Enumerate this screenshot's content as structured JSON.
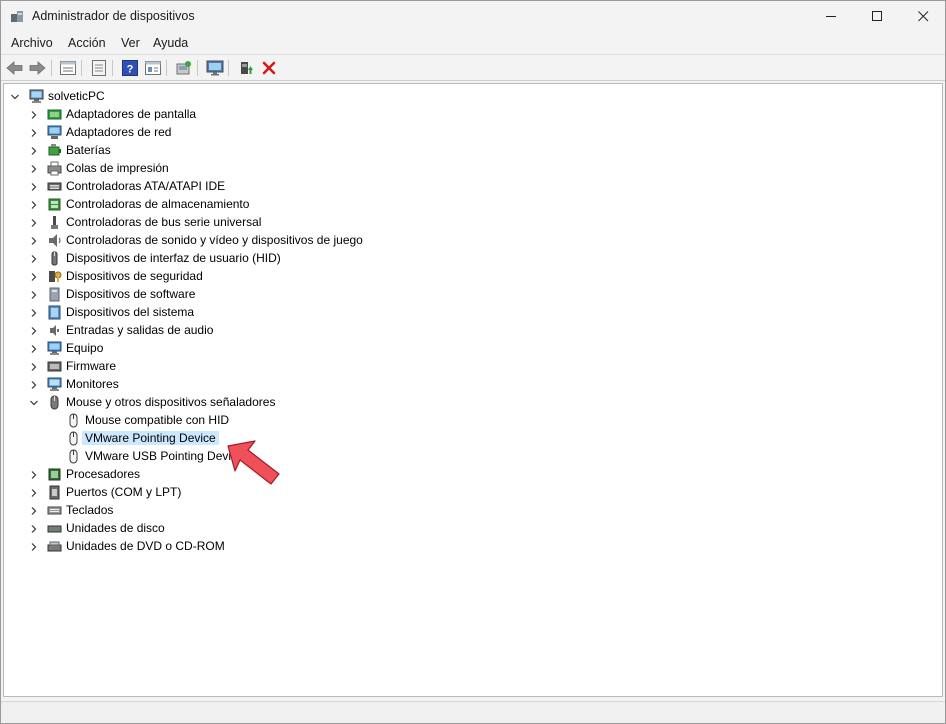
{
  "window": {
    "title": "Administrador de dispositivos"
  },
  "menu": [
    "Archivo",
    "Acción",
    "Ver",
    "Ayuda"
  ],
  "toolbar_icons": [
    "back-arrow-icon",
    "forward-arrow-icon",
    "properties-icon",
    "document-icon",
    "help-icon",
    "view-icon",
    "scan-hardware-icon",
    "monitor-icon",
    "update-driver-icon",
    "uninstall-x-icon"
  ],
  "tree": {
    "root": "solveticPC",
    "categories": [
      {
        "label": "Adaptadores de pantalla",
        "icon": "display-adapter-icon",
        "expanded": false
      },
      {
        "label": "Adaptadores de red",
        "icon": "network-adapter-icon",
        "expanded": false
      },
      {
        "label": "Baterías",
        "icon": "battery-icon",
        "expanded": false
      },
      {
        "label": "Colas de impresión",
        "icon": "printer-icon",
        "expanded": false
      },
      {
        "label": "Controladoras ATA/ATAPI IDE",
        "icon": "ide-controller-icon",
        "expanded": false
      },
      {
        "label": "Controladoras de almacenamiento",
        "icon": "storage-controller-icon",
        "expanded": false
      },
      {
        "label": "Controladoras de bus serie universal",
        "icon": "usb-icon",
        "expanded": false
      },
      {
        "label": "Controladoras de sonido y vídeo y dispositivos de juego",
        "icon": "speaker-icon",
        "expanded": false
      },
      {
        "label": "Dispositivos de interfaz de usuario (HID)",
        "icon": "hid-icon",
        "expanded": false
      },
      {
        "label": "Dispositivos de seguridad",
        "icon": "security-key-icon",
        "expanded": false
      },
      {
        "label": "Dispositivos de software",
        "icon": "software-device-icon",
        "expanded": false
      },
      {
        "label": "Dispositivos del sistema",
        "icon": "system-device-icon",
        "expanded": false
      },
      {
        "label": "Entradas y salidas de audio",
        "icon": "audio-io-icon",
        "expanded": false
      },
      {
        "label": "Equipo",
        "icon": "computer-icon",
        "expanded": false
      },
      {
        "label": "Firmware",
        "icon": "firmware-icon",
        "expanded": false
      },
      {
        "label": "Monitores",
        "icon": "monitor-icon",
        "expanded": false
      },
      {
        "label": "Mouse y otros dispositivos señaladores",
        "icon": "mouse-icon",
        "expanded": true,
        "children": [
          {
            "label": "Mouse compatible con HID",
            "selected": false
          },
          {
            "label": "VMware Pointing Device",
            "selected": true
          },
          {
            "label": "VMware USB Pointing Device",
            "selected": false
          }
        ]
      },
      {
        "label": "Procesadores",
        "icon": "processor-icon",
        "expanded": false
      },
      {
        "label": "Puertos (COM y LPT)",
        "icon": "port-icon",
        "expanded": false
      },
      {
        "label": "Teclados",
        "icon": "keyboard-icon",
        "expanded": false
      },
      {
        "label": "Unidades de disco",
        "icon": "disk-drive-icon",
        "expanded": false
      },
      {
        "label": "Unidades de DVD o CD-ROM",
        "icon": "dvd-drive-icon",
        "expanded": false
      }
    ]
  },
  "colors": {
    "selection": "#cce8ff",
    "pointer_arrow": "#f0505a",
    "delete_red": "#d11a1a"
  }
}
